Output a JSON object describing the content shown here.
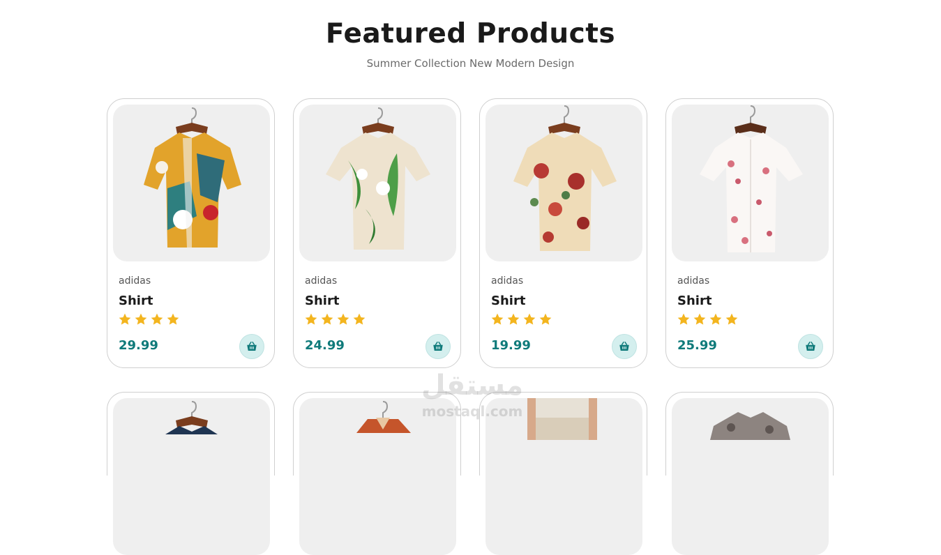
{
  "section": {
    "title": "Featured Products",
    "subtitle": "Summer Collection New Modern Design"
  },
  "colors": {
    "accent": "#0f7a7a",
    "star": "#f3b51f",
    "cart_bg": "#d4efee",
    "thumb_bg": "#efefef"
  },
  "products": [
    {
      "brand": "adidas",
      "name": "Shirt",
      "rating": 4,
      "price": "29.99",
      "image": "colorful-abstract-print-shirt",
      "icon": "basket-icon"
    },
    {
      "brand": "adidas",
      "name": "Shirt",
      "rating": 4,
      "price": "24.99",
      "image": "leaf-floral-print-shirt",
      "icon": "basket-icon"
    },
    {
      "brand": "adidas",
      "name": "Shirt",
      "rating": 4,
      "price": "19.99",
      "image": "red-floral-print-shirt",
      "icon": "basket-icon"
    },
    {
      "brand": "adidas",
      "name": "Shirt",
      "rating": 4,
      "price": "25.99",
      "image": "pink-blossom-print-shirt",
      "icon": "basket-icon"
    }
  ],
  "products_row2_images": [
    "navy-shirt",
    "orange-shirt",
    "linen-pants-model",
    "grey-patterned-shirt"
  ],
  "watermark": {
    "arabic": "مستقل",
    "latin": "mostaql.com"
  }
}
